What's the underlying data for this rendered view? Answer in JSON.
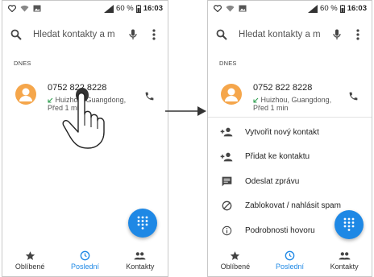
{
  "status": {
    "battery": "60 %",
    "time": "16:03"
  },
  "search": {
    "placeholder": "Hledat kontakty a m"
  },
  "section_label": "DNES",
  "call": {
    "number": "0752 822 8228",
    "location": "Huizhou, Guangdong,",
    "time": "Před 1 min"
  },
  "menu": [
    {
      "icon": "add-contact-icon",
      "label": "Vytvořit nový kontakt"
    },
    {
      "icon": "add-to-contact-icon",
      "label": "Přidat ke kontaktu"
    },
    {
      "icon": "message-icon",
      "label": "Odeslat zprávu"
    },
    {
      "icon": "block-icon",
      "label": "Zablokovat / nahlásit spam"
    },
    {
      "icon": "info-icon",
      "label": "Podrobnosti hovoru"
    }
  ],
  "nav": [
    {
      "icon": "star-icon",
      "label": "Oblíbené"
    },
    {
      "icon": "clock-icon",
      "label": "Poslední",
      "active": true
    },
    {
      "icon": "people-icon",
      "label": "Kontakty"
    }
  ],
  "colors": {
    "accent": "#1e88e5",
    "avatar": "#f5a64b",
    "missed_arrow": "#2e9e4f"
  }
}
